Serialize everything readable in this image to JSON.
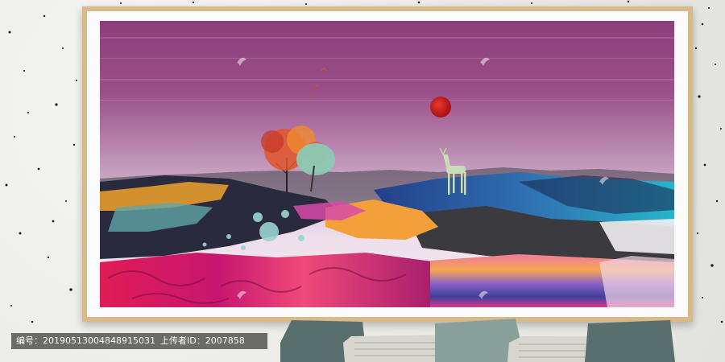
{
  "watermark": {
    "id_label": "编号",
    "id_value": "20190513004848915031",
    "uploader_label": "上传者ID",
    "uploader_value": "2007858"
  },
  "colors": {
    "sky_top": "#8c3f7a",
    "sky_bottom": "#f1e6ee",
    "sun": "#c8161c",
    "frame": "#d8b98a",
    "mat": "#fbfbfb",
    "pillow_teal": "#56706e",
    "pillow_stripe": "#d9d9d2"
  },
  "icons": [
    "bird-logo-icon"
  ]
}
